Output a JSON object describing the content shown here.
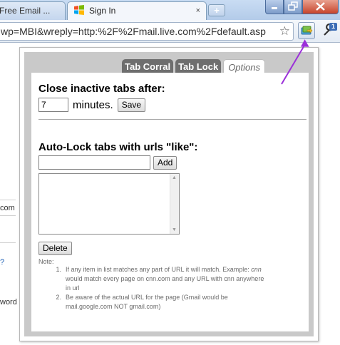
{
  "browser": {
    "tabs": [
      {
        "label": "Free Email ...",
        "active": false
      },
      {
        "label": "Sign In",
        "active": true
      }
    ],
    "tab_close_glyph": "×",
    "new_tab_glyph": "+",
    "url": "wp=MBI&wreply=http:%2F%2Fmail.live.com%2Fdefault.asp",
    "star_glyph": "☆",
    "extension_icon": "tab-corral-extension-icon",
    "wrench_badge": "1"
  },
  "background_page": {
    "fragments": [
      "com",
      "?",
      "word"
    ]
  },
  "popup": {
    "tabs": [
      "Tab Corral",
      "Tab Lock",
      "Options"
    ],
    "active_tab": "Options",
    "close_heading": "Close inactive tabs after:",
    "minutes_value": "7",
    "minutes_label": "minutes.",
    "save_label": "Save",
    "autolock_heading": "Auto-Lock tabs with urls \"like\":",
    "url_input_value": "",
    "add_label": "Add",
    "delete_label": "Delete",
    "note_title": "Note:",
    "notes": [
      {
        "num": "1.",
        "before": "If any item in list matches any part of URL it will match. Example: ",
        "example": "cnn",
        "after": " would match every page on cnn.com and any URL with cnn anywhere in url"
      },
      {
        "num": "2.",
        "text": "Be aware of the actual URL for the page (Gmail would be mail.google.com NOT gmail.com)"
      }
    ]
  },
  "colors": {
    "arrow": "#9b30d9",
    "popup_frame": "#c9c9c9",
    "tab_dark": "#6e6e6e"
  }
}
